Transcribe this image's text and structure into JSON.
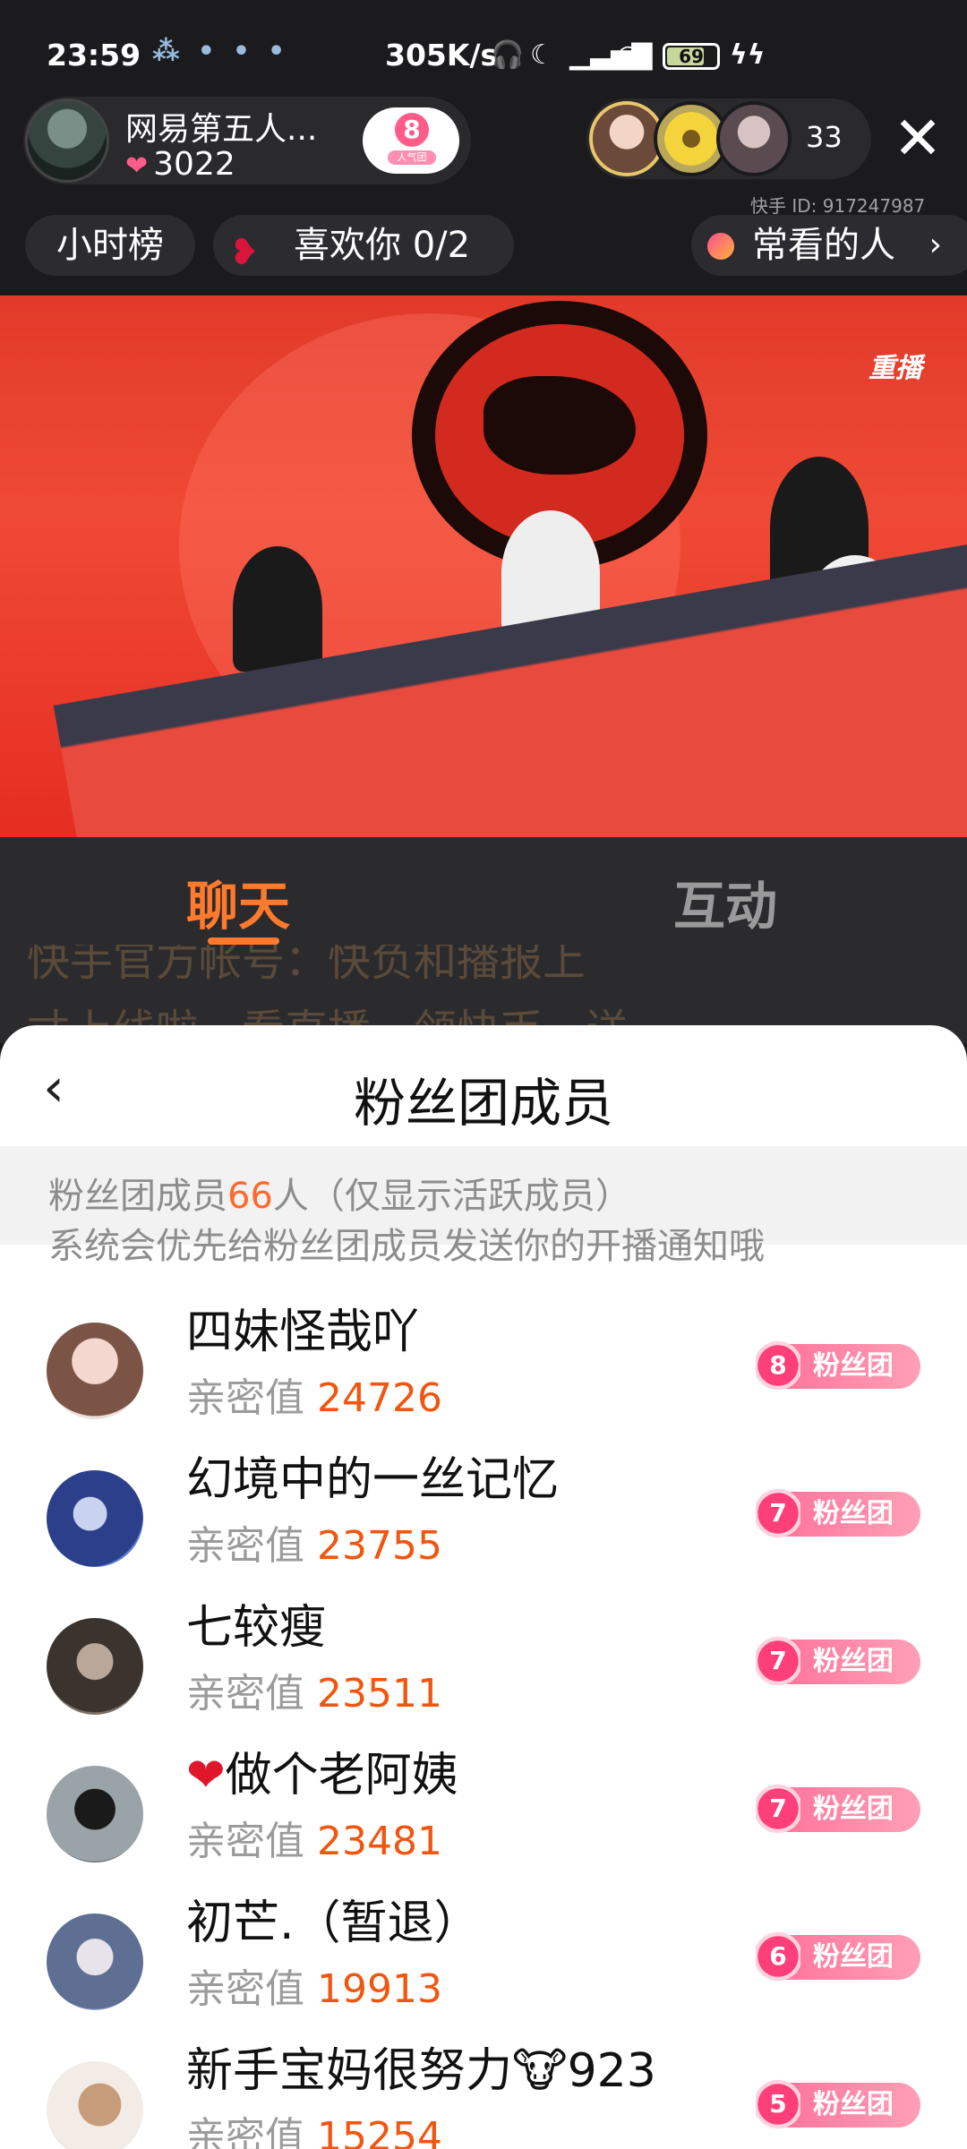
{
  "status_bar": {
    "time": "23:59",
    "speed": "305K/s",
    "battery": "69"
  },
  "host": {
    "name": "网易第五人...",
    "likes": "3022",
    "fan_level": "8",
    "fan_label": "人气团"
  },
  "viewers": {
    "count": "33"
  },
  "kuaishou_id": "快手 ID: 917247987",
  "pills": {
    "hour_rank": "小时榜",
    "like_you": "喜欢你 0/2",
    "often_watch": "常看的人"
  },
  "video": {
    "replay_label": "重播"
  },
  "tabs": {
    "chat": "聊天",
    "interact": "互动"
  },
  "chat_behind": {
    "line1": "快手官方帐号：快负和播报上",
    "line2": "寸上线啦，看直播，领快币，送"
  },
  "panel": {
    "title": "粉丝团成员",
    "info_prefix": "粉丝团成员",
    "member_count": "66",
    "info_suffix": "人（仅显示活跃成员）",
    "notice": "系统会优先给粉丝团成员发送你的开播通知哦",
    "intimacy_label": "亲密值",
    "badge_label": "粉丝团",
    "members": [
      {
        "name": "四妹怪哉吖",
        "intimacy": "24726",
        "level": "8"
      },
      {
        "name": "幻境中的一丝记忆",
        "intimacy": "23755",
        "level": "7"
      },
      {
        "name": "七较瘦",
        "intimacy": "23511",
        "level": "7"
      },
      {
        "emoji": "❤",
        "name": "做个老阿姨",
        "intimacy": "23481",
        "level": "7"
      },
      {
        "name": "初芒.（暂退）",
        "intimacy": "19913",
        "level": "6"
      },
      {
        "name": "新手宝妈很努力",
        "emoji2": "🐮",
        "suffix": "923",
        "intimacy": "15254",
        "level": "5"
      }
    ]
  },
  "colors": {
    "accent": "#ff7a2d",
    "intimacy_value": "#f0560f",
    "badge_pink": "#ff6f98"
  }
}
